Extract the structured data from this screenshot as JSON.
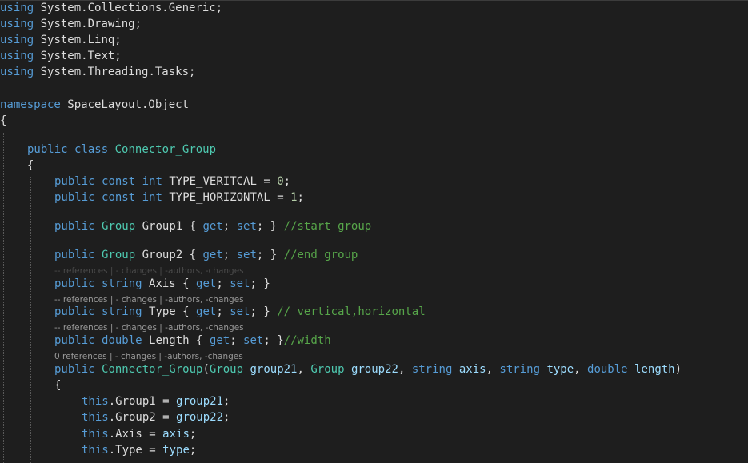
{
  "lines": [
    {
      "id": "l1",
      "tokens": [
        {
          "c": "kw",
          "t": "using"
        },
        {
          "c": "id",
          "t": " System.Collections.Generic;"
        }
      ]
    },
    {
      "id": "l2",
      "tokens": [
        {
          "c": "kw",
          "t": "using"
        },
        {
          "c": "id",
          "t": " System.Drawing;"
        }
      ]
    },
    {
      "id": "l3",
      "tokens": [
        {
          "c": "kw",
          "t": "using"
        },
        {
          "c": "id",
          "t": " System.Linq;"
        }
      ]
    },
    {
      "id": "l4",
      "tokens": [
        {
          "c": "kw",
          "t": "using"
        },
        {
          "c": "id",
          "t": " System.Text;"
        }
      ]
    },
    {
      "id": "l5",
      "tokens": [
        {
          "c": "kw",
          "t": "using"
        },
        {
          "c": "id",
          "t": " System.Threading.Tasks;"
        }
      ]
    },
    {
      "id": "l6",
      "tokens": [
        {
          "c": "kw",
          "t": "namespace"
        },
        {
          "c": "id",
          "t": " SpaceLayout.Object"
        }
      ]
    },
    {
      "id": "l7",
      "tokens": [
        {
          "c": "punc",
          "t": "{"
        }
      ]
    },
    {
      "id": "l8",
      "tokens": [
        {
          "c": "kw",
          "t": "public"
        },
        {
          "c": "id",
          "t": " "
        },
        {
          "c": "kw",
          "t": "class"
        },
        {
          "c": "id",
          "t": " "
        },
        {
          "c": "type",
          "t": "Connector_Group"
        }
      ]
    },
    {
      "id": "l9",
      "tokens": [
        {
          "c": "punc",
          "t": "{"
        }
      ]
    },
    {
      "id": "l10",
      "tokens": [
        {
          "c": "kw",
          "t": "public"
        },
        {
          "c": "id",
          "t": " "
        },
        {
          "c": "kw",
          "t": "const"
        },
        {
          "c": "id",
          "t": " "
        },
        {
          "c": "kw",
          "t": "int"
        },
        {
          "c": "id",
          "t": " TYPE_VERITCAL = "
        },
        {
          "c": "num",
          "t": "0"
        },
        {
          "c": "id",
          "t": ";"
        }
      ]
    },
    {
      "id": "l11",
      "tokens": [
        {
          "c": "kw",
          "t": "public"
        },
        {
          "c": "id",
          "t": " "
        },
        {
          "c": "kw",
          "t": "const"
        },
        {
          "c": "id",
          "t": " "
        },
        {
          "c": "kw",
          "t": "int"
        },
        {
          "c": "id",
          "t": " TYPE_HORIZONTAL = "
        },
        {
          "c": "num",
          "t": "1"
        },
        {
          "c": "id",
          "t": ";"
        }
      ]
    },
    {
      "id": "l12",
      "tokens": [
        {
          "c": "kw",
          "t": "public"
        },
        {
          "c": "id",
          "t": " "
        },
        {
          "c": "type",
          "t": "Group"
        },
        {
          "c": "id",
          "t": " Group1 { "
        },
        {
          "c": "kw",
          "t": "get"
        },
        {
          "c": "id",
          "t": "; "
        },
        {
          "c": "kw",
          "t": "set"
        },
        {
          "c": "id",
          "t": "; } "
        },
        {
          "c": "cm",
          "t": "//start group"
        }
      ]
    },
    {
      "id": "l13",
      "tokens": [
        {
          "c": "kw",
          "t": "public"
        },
        {
          "c": "id",
          "t": " "
        },
        {
          "c": "type",
          "t": "Group"
        },
        {
          "c": "id",
          "t": " Group2 { "
        },
        {
          "c": "kw",
          "t": "get"
        },
        {
          "c": "id",
          "t": "; "
        },
        {
          "c": "kw",
          "t": "set"
        },
        {
          "c": "id",
          "t": "; } "
        },
        {
          "c": "cm",
          "t": "//end group"
        }
      ]
    },
    {
      "id": "l14",
      "tokens": [
        {
          "c": "kw",
          "t": "public"
        },
        {
          "c": "id",
          "t": " "
        },
        {
          "c": "kw",
          "t": "string"
        },
        {
          "c": "id",
          "t": " Axis { "
        },
        {
          "c": "kw",
          "t": "get"
        },
        {
          "c": "id",
          "t": "; "
        },
        {
          "c": "kw",
          "t": "set"
        },
        {
          "c": "id",
          "t": "; }"
        }
      ]
    },
    {
      "id": "l15",
      "tokens": [
        {
          "c": "kw",
          "t": "public"
        },
        {
          "c": "id",
          "t": " "
        },
        {
          "c": "kw",
          "t": "string"
        },
        {
          "c": "id",
          "t": " Type { "
        },
        {
          "c": "kw",
          "t": "get"
        },
        {
          "c": "id",
          "t": "; "
        },
        {
          "c": "kw",
          "t": "set"
        },
        {
          "c": "id",
          "t": "; } "
        },
        {
          "c": "cm",
          "t": "// vertical,horizontal"
        }
      ]
    },
    {
      "id": "l16",
      "tokens": [
        {
          "c": "kw",
          "t": "public"
        },
        {
          "c": "id",
          "t": " "
        },
        {
          "c": "kw",
          "t": "double"
        },
        {
          "c": "id",
          "t": " Length { "
        },
        {
          "c": "kw",
          "t": "get"
        },
        {
          "c": "id",
          "t": "; "
        },
        {
          "c": "kw",
          "t": "set"
        },
        {
          "c": "id",
          "t": "; }"
        },
        {
          "c": "cm",
          "t": "//width"
        }
      ]
    },
    {
      "id": "l17",
      "tokens": [
        {
          "c": "kw",
          "t": "public"
        },
        {
          "c": "id",
          "t": " "
        },
        {
          "c": "type",
          "t": "Connector_Group"
        },
        {
          "c": "id",
          "t": "("
        },
        {
          "c": "type",
          "t": "Group"
        },
        {
          "c": "id",
          "t": " "
        },
        {
          "c": "param",
          "t": "group21"
        },
        {
          "c": "id",
          "t": ", "
        },
        {
          "c": "type",
          "t": "Group"
        },
        {
          "c": "id",
          "t": " "
        },
        {
          "c": "param",
          "t": "group22"
        },
        {
          "c": "id",
          "t": ", "
        },
        {
          "c": "kw",
          "t": "string"
        },
        {
          "c": "id",
          "t": " "
        },
        {
          "c": "param",
          "t": "axis"
        },
        {
          "c": "id",
          "t": ", "
        },
        {
          "c": "kw",
          "t": "string"
        },
        {
          "c": "id",
          "t": " "
        },
        {
          "c": "param",
          "t": "type"
        },
        {
          "c": "id",
          "t": ", "
        },
        {
          "c": "kw",
          "t": "double"
        },
        {
          "c": "id",
          "t": " "
        },
        {
          "c": "param",
          "t": "length"
        },
        {
          "c": "id",
          "t": ")"
        }
      ]
    },
    {
      "id": "l18",
      "tokens": [
        {
          "c": "punc",
          "t": "{"
        }
      ]
    },
    {
      "id": "l19",
      "tokens": [
        {
          "c": "kw",
          "t": "this"
        },
        {
          "c": "id",
          "t": ".Group1 = "
        },
        {
          "c": "param",
          "t": "group21"
        },
        {
          "c": "id",
          "t": ";"
        }
      ]
    },
    {
      "id": "l20",
      "tokens": [
        {
          "c": "kw",
          "t": "this"
        },
        {
          "c": "id",
          "t": ".Group2 = "
        },
        {
          "c": "param",
          "t": "group22"
        },
        {
          "c": "id",
          "t": ";"
        }
      ]
    },
    {
      "id": "l21",
      "tokens": [
        {
          "c": "kw",
          "t": "this"
        },
        {
          "c": "id",
          "t": ".Axis = "
        },
        {
          "c": "param",
          "t": "axis"
        },
        {
          "c": "id",
          "t": ";"
        }
      ]
    },
    {
      "id": "l22",
      "tokens": [
        {
          "c": "kw",
          "t": "this"
        },
        {
          "c": "id",
          "t": ".Type = "
        },
        {
          "c": "param",
          "t": "type"
        },
        {
          "c": "id",
          "t": ";"
        }
      ]
    }
  ],
  "codelens": {
    "axis": "-- references | - changes | -authors, -changes",
    "type": "-- references | - changes | -authors, -changes",
    "length": "-- references | - changes | -authors, -changes",
    "ctor": "0 references | - changes | -authors, -changes"
  },
  "colors": {
    "background": "#1e1e1e",
    "keyword": "#569cd6",
    "type": "#4ec9b0",
    "comment": "#57a64a",
    "identifier": "#dcdcdc",
    "parameter": "#9cdcfe",
    "number": "#b5cea8",
    "codelens": "#999999"
  }
}
